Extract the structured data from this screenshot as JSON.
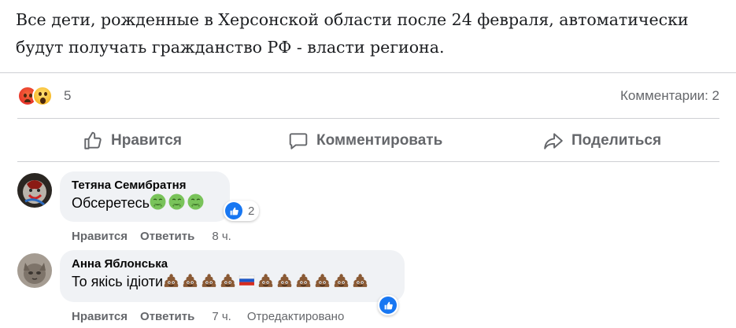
{
  "post": {
    "text": "Все дети, рожденные в Херсонской области после 24 февраля, автоматически будут получать гражданство РФ - власти региона."
  },
  "summary": {
    "reaction_icons": [
      "angry-reaction-icon",
      "wow-reaction-icon"
    ],
    "reaction_count": "5",
    "comments_label": "Комментарии: 2"
  },
  "actions": {
    "like": "Нравится",
    "comment": "Комментировать",
    "share": "Поделиться"
  },
  "comments": [
    {
      "author": "Тетяна Семибратня",
      "text": "Обсеретесь",
      "emojis": [
        "nauseated-face",
        "nauseated-face",
        "nauseated-face"
      ],
      "like_count": "2",
      "like_label": "Нравится",
      "reply_label": "Ответить",
      "time": "8 ч."
    },
    {
      "author": "Анна Яблонська",
      "text": "То якісь ідіоти",
      "emojis": [
        "pile-of-poo",
        "pile-of-poo",
        "pile-of-poo",
        "pile-of-poo",
        "flag-russia",
        "pile-of-poo",
        "pile-of-poo",
        "pile-of-poo",
        "pile-of-poo",
        "pile-of-poo",
        "pile-of-poo"
      ],
      "like_label": "Нравится",
      "reply_label": "Ответить",
      "time": "7 ч.",
      "edited_label": "Отредактировано"
    }
  ],
  "colors": {
    "facebook_blue": "#1877f2",
    "bubble_bg": "#f0f2f5",
    "secondary_text": "#65676b"
  }
}
